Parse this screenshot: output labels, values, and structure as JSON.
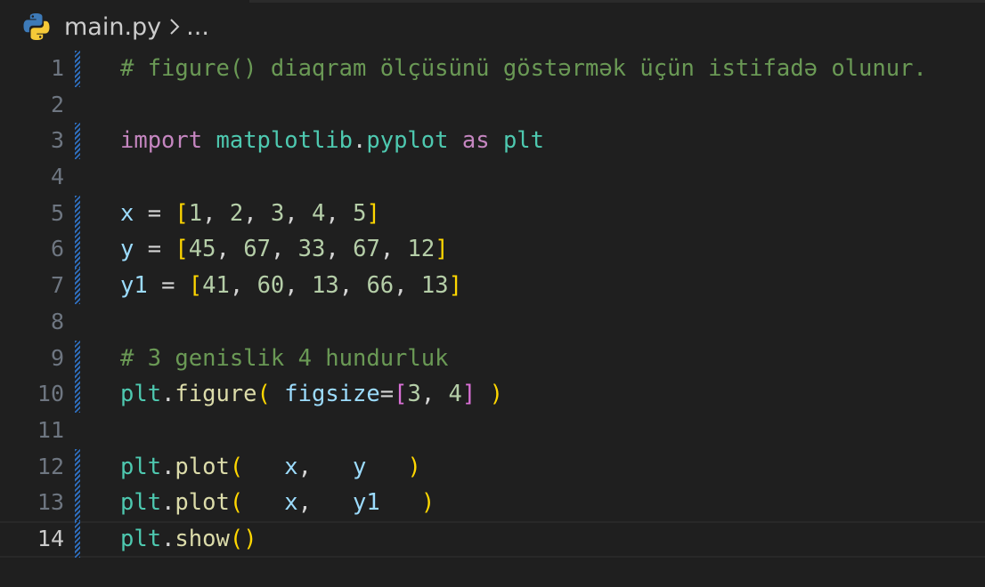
{
  "breadcrumb": {
    "file_name": "main.py",
    "separator": "›",
    "more": "..."
  },
  "lines": [
    {
      "number": "1",
      "modified": true,
      "tokens": [
        {
          "t": "# figure() diaqram ölçüsünü göstərmək üçün istifadə olunur.",
          "c": "comment"
        }
      ]
    },
    {
      "number": "2",
      "modified": false,
      "tokens": []
    },
    {
      "number": "3",
      "modified": true,
      "tokens": [
        {
          "t": "import",
          "c": "kw"
        },
        {
          "t": " ",
          "c": "op"
        },
        {
          "t": "matplotlib",
          "c": "mod"
        },
        {
          "t": ".",
          "c": "op"
        },
        {
          "t": "pyplot",
          "c": "mod"
        },
        {
          "t": " ",
          "c": "op"
        },
        {
          "t": "as",
          "c": "kw"
        },
        {
          "t": " ",
          "c": "op"
        },
        {
          "t": "plt",
          "c": "mod"
        }
      ]
    },
    {
      "number": "4",
      "modified": false,
      "tokens": []
    },
    {
      "number": "5",
      "modified": true,
      "tokens": [
        {
          "t": "x",
          "c": "var"
        },
        {
          "t": " = ",
          "c": "op"
        },
        {
          "t": "[",
          "c": "br1"
        },
        {
          "t": "1",
          "c": "num"
        },
        {
          "t": ", ",
          "c": "op"
        },
        {
          "t": "2",
          "c": "num"
        },
        {
          "t": ", ",
          "c": "op"
        },
        {
          "t": "3",
          "c": "num"
        },
        {
          "t": ", ",
          "c": "op"
        },
        {
          "t": "4",
          "c": "num"
        },
        {
          "t": ", ",
          "c": "op"
        },
        {
          "t": "5",
          "c": "num"
        },
        {
          "t": "]",
          "c": "br1"
        }
      ]
    },
    {
      "number": "6",
      "modified": true,
      "tokens": [
        {
          "t": "y",
          "c": "var"
        },
        {
          "t": " = ",
          "c": "op"
        },
        {
          "t": "[",
          "c": "br1"
        },
        {
          "t": "45",
          "c": "num"
        },
        {
          "t": ", ",
          "c": "op"
        },
        {
          "t": "67",
          "c": "num"
        },
        {
          "t": ", ",
          "c": "op"
        },
        {
          "t": "33",
          "c": "num"
        },
        {
          "t": ", ",
          "c": "op"
        },
        {
          "t": "67",
          "c": "num"
        },
        {
          "t": ", ",
          "c": "op"
        },
        {
          "t": "12",
          "c": "num"
        },
        {
          "t": "]",
          "c": "br1"
        }
      ]
    },
    {
      "number": "7",
      "modified": true,
      "tokens": [
        {
          "t": "y1",
          "c": "var"
        },
        {
          "t": " = ",
          "c": "op"
        },
        {
          "t": "[",
          "c": "br1"
        },
        {
          "t": "41",
          "c": "num"
        },
        {
          "t": ", ",
          "c": "op"
        },
        {
          "t": "60",
          "c": "num"
        },
        {
          "t": ", ",
          "c": "op"
        },
        {
          "t": "13",
          "c": "num"
        },
        {
          "t": ", ",
          "c": "op"
        },
        {
          "t": "66",
          "c": "num"
        },
        {
          "t": ", ",
          "c": "op"
        },
        {
          "t": "13",
          "c": "num"
        },
        {
          "t": "]",
          "c": "br1"
        }
      ]
    },
    {
      "number": "8",
      "modified": false,
      "tokens": []
    },
    {
      "number": "9",
      "modified": true,
      "tokens": [
        {
          "t": "# 3 genislik 4 hundurluk",
          "c": "comment"
        }
      ]
    },
    {
      "number": "10",
      "modified": true,
      "tokens": [
        {
          "t": "plt",
          "c": "mod"
        },
        {
          "t": ".",
          "c": "op"
        },
        {
          "t": "figure",
          "c": "fn"
        },
        {
          "t": "(",
          "c": "br1"
        },
        {
          "t": " ",
          "c": "op"
        },
        {
          "t": "figsize",
          "c": "var"
        },
        {
          "t": "=",
          "c": "op"
        },
        {
          "t": "[",
          "c": "br2"
        },
        {
          "t": "3",
          "c": "num"
        },
        {
          "t": ", ",
          "c": "op"
        },
        {
          "t": "4",
          "c": "num"
        },
        {
          "t": "]",
          "c": "br2"
        },
        {
          "t": " ",
          "c": "op"
        },
        {
          "t": ")",
          "c": "br1"
        }
      ]
    },
    {
      "number": "11",
      "modified": false,
      "tokens": []
    },
    {
      "number": "12",
      "modified": true,
      "tokens": [
        {
          "t": "plt",
          "c": "mod"
        },
        {
          "t": ".",
          "c": "op"
        },
        {
          "t": "plot",
          "c": "fn"
        },
        {
          "t": "(",
          "c": "br1"
        },
        {
          "t": "   ",
          "c": "op"
        },
        {
          "t": "x",
          "c": "var"
        },
        {
          "t": ",   ",
          "c": "op"
        },
        {
          "t": "y",
          "c": "var"
        },
        {
          "t": "   ",
          "c": "op"
        },
        {
          "t": ")",
          "c": "br1"
        }
      ]
    },
    {
      "number": "13",
      "modified": true,
      "tokens": [
        {
          "t": "plt",
          "c": "mod"
        },
        {
          "t": ".",
          "c": "op"
        },
        {
          "t": "plot",
          "c": "fn"
        },
        {
          "t": "(",
          "c": "br1"
        },
        {
          "t": "   ",
          "c": "op"
        },
        {
          "t": "x",
          "c": "var"
        },
        {
          "t": ",   ",
          "c": "op"
        },
        {
          "t": "y1",
          "c": "var"
        },
        {
          "t": "   ",
          "c": "op"
        },
        {
          "t": ")",
          "c": "br1"
        }
      ]
    },
    {
      "number": "14",
      "modified": true,
      "current": true,
      "tokens": [
        {
          "t": "plt",
          "c": "mod"
        },
        {
          "t": ".",
          "c": "op"
        },
        {
          "t": "show",
          "c": "fn"
        },
        {
          "t": "(",
          "c": "br1"
        },
        {
          "t": ")",
          "c": "br1"
        }
      ]
    }
  ]
}
